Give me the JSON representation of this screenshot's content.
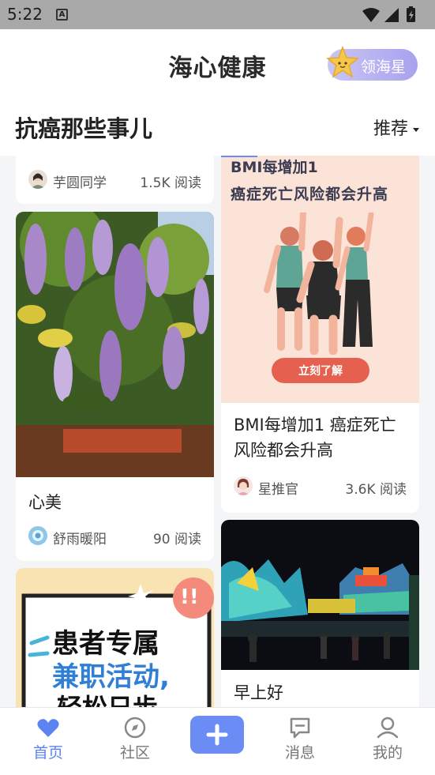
{
  "status_bar": {
    "time": "5:22",
    "notification_letter": "A"
  },
  "header": {
    "app_title": "海心健康",
    "star_button_label": "领海星"
  },
  "section": {
    "title": "抗癌那些事儿",
    "sort_label": "推荐"
  },
  "feed": {
    "left": [
      {
        "title": "",
        "author": "芋圆同学",
        "reads": "1.5K 阅读"
      },
      {
        "title": "心美",
        "author": "舒雨暖阳",
        "reads": "90 阅读"
      },
      {
        "image_text_line1": "患者专属",
        "image_text_line2": "兼职活动,",
        "image_text_line3": "轻松日步"
      }
    ],
    "right": [
      {
        "image_text_line1": "BMI每增加1",
        "image_text_line2": "癌症死亡风险都会升高",
        "image_button": "立刻了解",
        "title": "BMI每增加1 癌症死亡风险都会升高",
        "author": "星推官",
        "reads": "3.6K 阅读"
      },
      {
        "title": "早上好"
      }
    ]
  },
  "tabbar": {
    "tabs": [
      {
        "label": "首页",
        "icon": "heart-icon",
        "active": true
      },
      {
        "label": "社区",
        "icon": "compass-icon",
        "active": false
      },
      {
        "label": "消息",
        "icon": "message-icon",
        "active": false
      },
      {
        "label": "我的",
        "icon": "profile-icon",
        "active": false
      }
    ],
    "add_icon": "plus-icon"
  },
  "colors": {
    "accent": "#5b84f2",
    "star_button": "#a8a1ee",
    "poster_bg": "#fbe4d7",
    "poster_title": "#3b3b52",
    "poster_highlight": "#e5604f"
  }
}
